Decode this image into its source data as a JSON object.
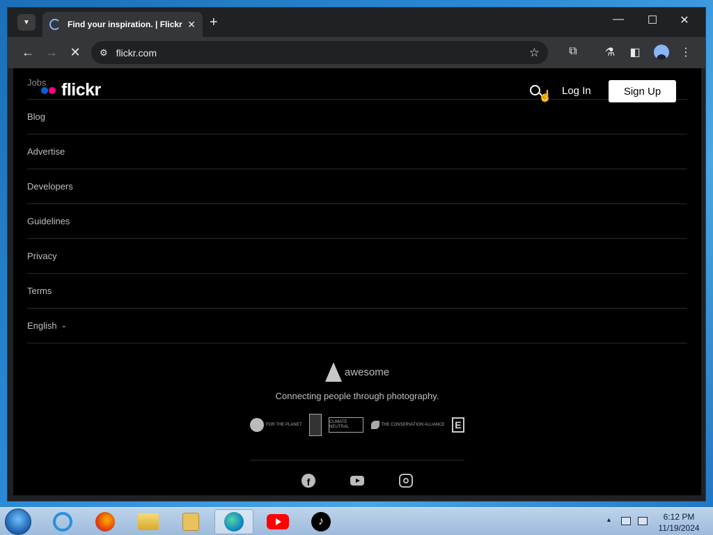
{
  "browser": {
    "tab_title": "Find your inspiration. | Flickr",
    "tab_close": "✕",
    "new_tab": "+",
    "url": "flickr.com",
    "window_controls": {
      "minimize": "—",
      "maximize": "☐",
      "close": "✕"
    },
    "nav": {
      "back": "←",
      "forward": "→",
      "stop": "✕"
    }
  },
  "header": {
    "logo": "flickr",
    "login": "Log In",
    "signup": "Sign Up"
  },
  "footer": {
    "links": [
      "Jobs",
      "Blog",
      "Advertise",
      "Developers",
      "Guidelines",
      "Privacy",
      "Terms"
    ],
    "language": "English",
    "brand": "awesome",
    "tagline": "Connecting people through photography.",
    "partners": {
      "one_percent": "FOR THE PLANET",
      "climate": "CLIMATE NEUTRAL",
      "conservation": "The Conservation Alliance",
      "e": "E"
    }
  },
  "taskbar": {
    "time": "6:12 PM",
    "date": "11/19/2024",
    "tiktok": "♪"
  },
  "colors": {
    "flickr_blue": "#0063dc",
    "flickr_pink": "#ff0084"
  }
}
